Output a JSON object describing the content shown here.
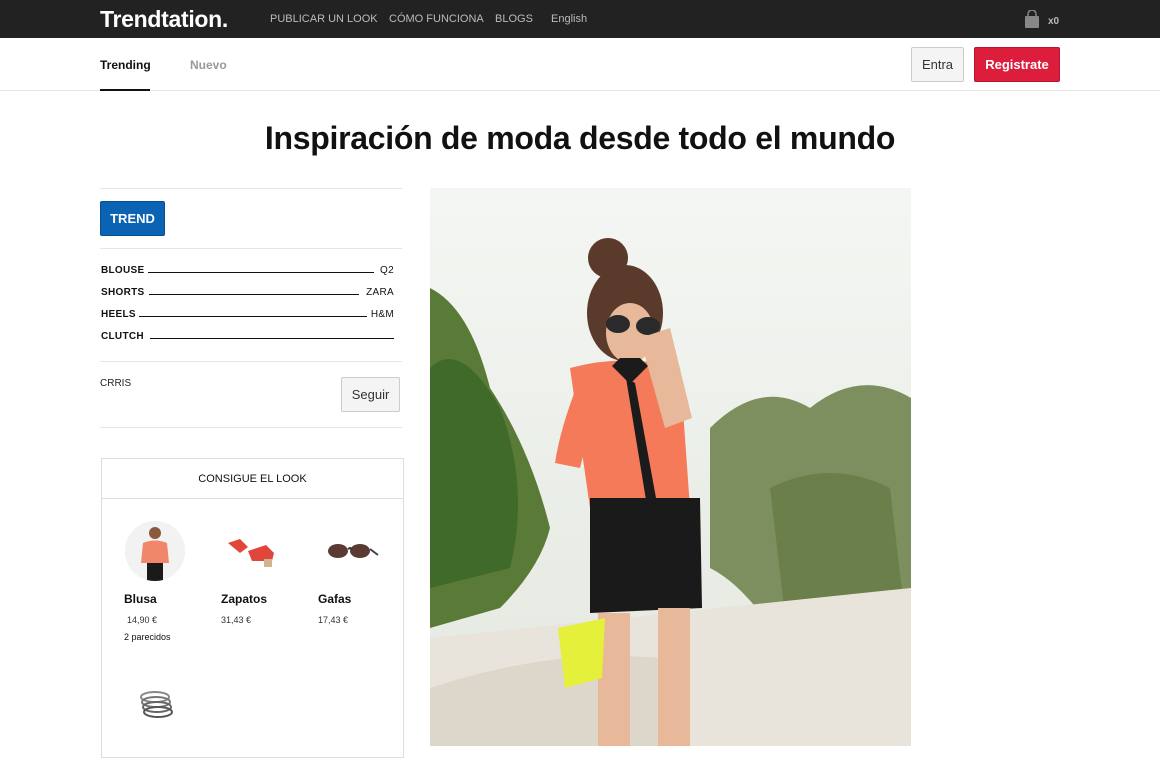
{
  "header": {
    "logo": "Trendtation.",
    "nav": [
      "PUBLICAR UN LOOK",
      "CÓMO FUNCIONA",
      "BLOGS",
      "English"
    ],
    "cart_count": "x0"
  },
  "subnav": {
    "tabs": [
      "Trending",
      "Nuevo"
    ],
    "login_label": "Entra",
    "register_label": "Registrate"
  },
  "headline": "Inspiración de moda desde todo el mundo",
  "look": {
    "trend_label": "TREND",
    "items": [
      {
        "name": "BLOUSE",
        "brand": "Q2"
      },
      {
        "name": "SHORTS",
        "brand": "ZARA"
      },
      {
        "name": "HEELS",
        "brand": "H&M"
      },
      {
        "name": "CLUTCH",
        "brand": ""
      }
    ],
    "user": "CRRIS",
    "follow_label": "Seguir"
  },
  "get_the_look": {
    "title": "CONSIGUE EL LOOK",
    "products": [
      {
        "name": "Blusa",
        "price": "14,90 €",
        "similar": "2 parecidos"
      },
      {
        "name": "Zapatos",
        "price": "31,43 €"
      },
      {
        "name": "Gafas",
        "price": "17,43 €"
      }
    ]
  },
  "colors": {
    "topbar": "#222222",
    "register": "#dc1e3c",
    "trend": "#0a63b3"
  }
}
